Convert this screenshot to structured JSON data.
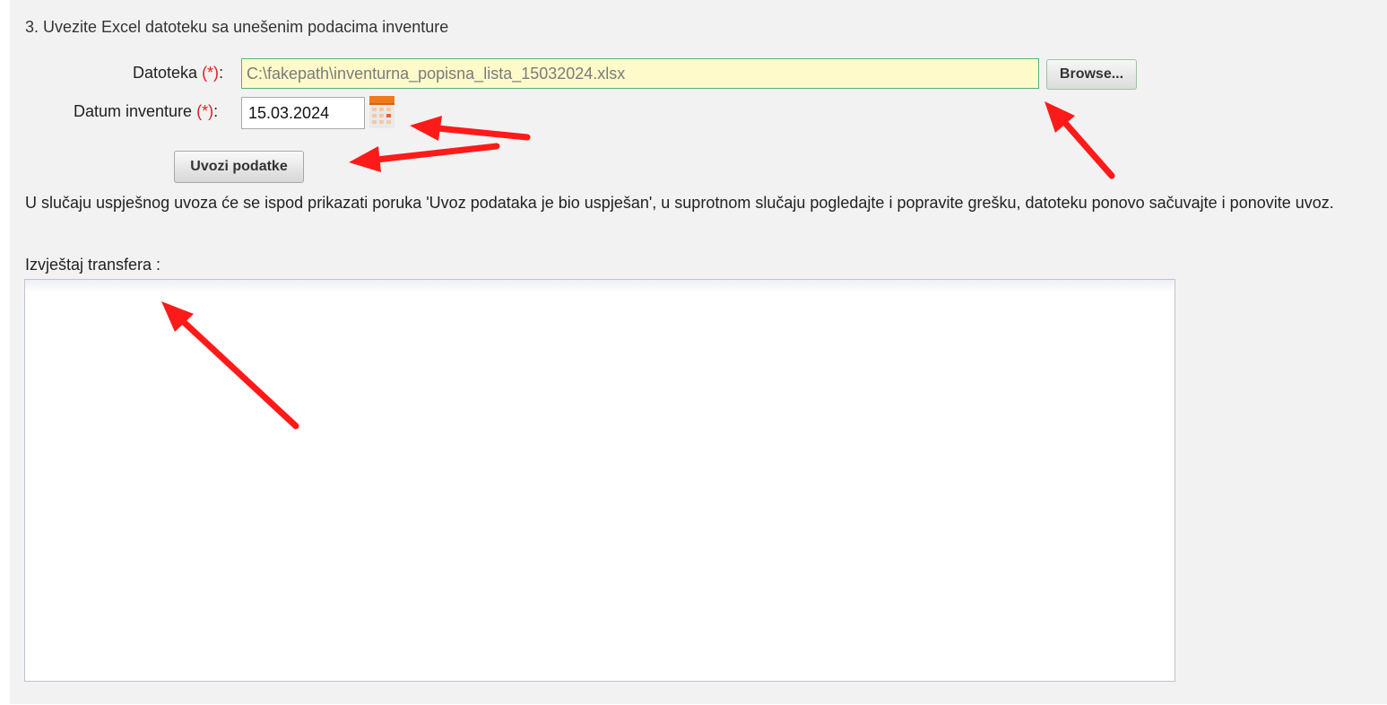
{
  "step_title": "3. Uvezite Excel datoteku sa unešenim podacima inventure",
  "file_field": {
    "label": "Datoteka",
    "required_marker": "(*)",
    "label_suffix": ":",
    "value": "C:\\fakepath\\inventurna_popisna_lista_15032024.xlsx",
    "browse_label": "Browse..."
  },
  "date_field": {
    "label": "Datum inventure",
    "required_marker": "(*)",
    "label_suffix": ":",
    "value": "15.03.2024",
    "icon": "calendar-icon"
  },
  "import_button_label": "Uvozi podatke",
  "info_text": "U slučaju uspješnog uvoza će se ispod prikazati poruka 'Uvoz podataka je bio uspješan', u suprotnom slučaju pogledajte i popravite grešku, datoteku ponovo sačuvajte i ponovite uvoz.",
  "report": {
    "label": "Izvještaj transfera :",
    "content": ""
  },
  "annotation_arrow_color": "#ff1a1a",
  "colors": {
    "file_input_bg": "#fefac9",
    "file_input_border": "#58b07a",
    "required": "#e0201f",
    "panel_bg": "#f2f2f2"
  }
}
